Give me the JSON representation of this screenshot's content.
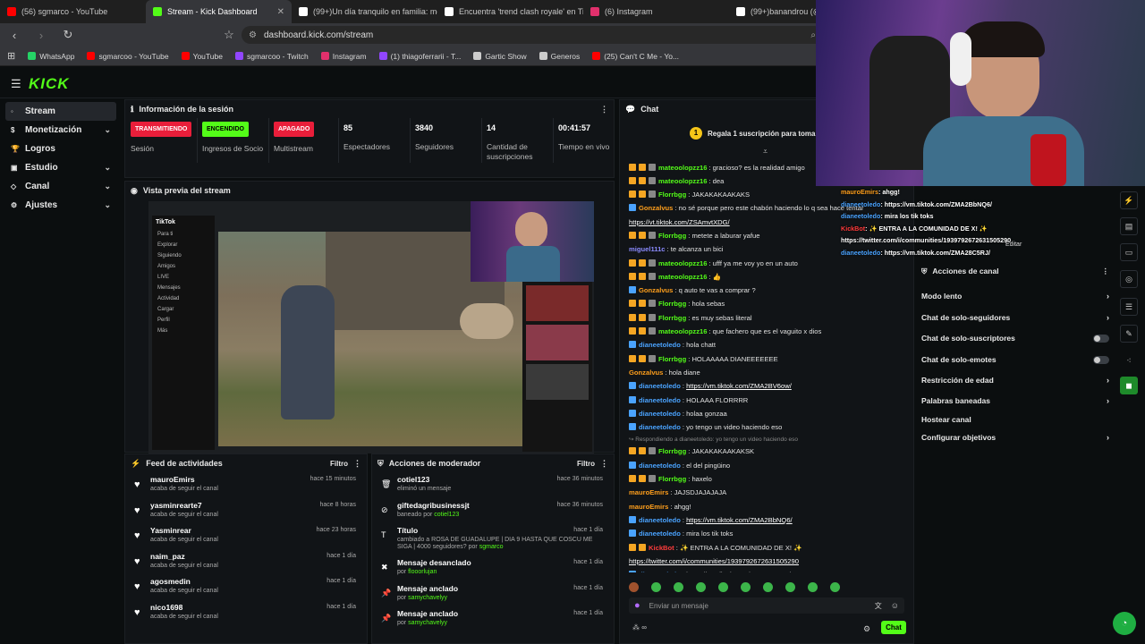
{
  "browser": {
    "tabs": [
      {
        "title": "(56) sgmarco - YouTube",
        "color": "#ff0000",
        "active": false
      },
      {
        "title": "Stream - Kick Dashboard",
        "color": "#53fc18",
        "active": true
      },
      {
        "title": "(99+)Un día tranquilo en familia: mo",
        "color": "#ffffff",
        "active": false
      },
      {
        "title": "Encuentra 'trend clash royale' en Tik",
        "color": "#ffffff",
        "active": false
      },
      {
        "title": "(6) Instagram",
        "color": "#e1306c",
        "active": false
      },
      {
        "title": "(99+)banandrou (@b",
        "color": "#ffffff",
        "active": false
      }
    ],
    "url": "dashboard.kick.com/stream",
    "bookmarks": [
      {
        "label": "WhatsApp",
        "color": "#25d366"
      },
      {
        "label": "sgmarcoo - YouTube",
        "color": "#ff0000"
      },
      {
        "label": "YouTube",
        "color": "#ff0000"
      },
      {
        "label": "sgmarcoo - Twitch",
        "color": "#9146ff"
      },
      {
        "label": "Instagram",
        "color": "#e1306c"
      },
      {
        "label": "(1) thiagoferrarii - T...",
        "color": "#9146ff"
      },
      {
        "label": "Gartic Show",
        "color": "#cccccc"
      },
      {
        "label": "Generos",
        "color": "#cccccc"
      },
      {
        "label": "(25) Can't C Me - Yo...",
        "color": "#ff0000"
      }
    ]
  },
  "app": {
    "logo": "KICK",
    "accent": "#53fc18"
  },
  "sidebar": {
    "items": [
      {
        "label": "Stream",
        "active": true,
        "chevron": false
      },
      {
        "label": "Monetización",
        "active": false,
        "chevron": true
      },
      {
        "label": "Logros",
        "active": false,
        "chevron": false
      },
      {
        "label": "Estudio",
        "active": false,
        "chevron": true
      },
      {
        "label": "Canal",
        "active": false,
        "chevron": true
      },
      {
        "label": "Ajustes",
        "active": false,
        "chevron": true
      }
    ]
  },
  "session": {
    "title": "Información de la sesión",
    "stats": [
      {
        "badge": "TRANSMITIENDO",
        "badge_color": "#e91e3a",
        "label": "Sesión"
      },
      {
        "badge": "ENCENDIDO",
        "badge_color": "#53fc18",
        "label": "Ingresos de Socio"
      },
      {
        "badge": "APAGADO",
        "badge_color": "#e91e3a",
        "label": "Multistream"
      },
      {
        "value": "85",
        "label": "Espectadores"
      },
      {
        "value": "3840",
        "label": "Seguidores"
      },
      {
        "value": "14",
        "label": "Cantidad de suscripciones"
      },
      {
        "value": "00:41:57",
        "label": "Tiempo en vivo"
      }
    ]
  },
  "preview": {
    "title": "Vista previa del stream"
  },
  "activity": {
    "title": "Feed de actividades",
    "filter": "Filtro",
    "items": [
      {
        "name": "mauroEmirs",
        "sub": "acaba de seguir el canal",
        "time": "hace 15 minutos"
      },
      {
        "name": "yasminrearte7",
        "sub": "acaba de seguir el canal",
        "time": "hace 8 horas"
      },
      {
        "name": "Yasminrear",
        "sub": "acaba de seguir el canal",
        "time": "hace 23 horas"
      },
      {
        "name": "naim_paz",
        "sub": "acaba de seguir el canal",
        "time": "hace 1 día"
      },
      {
        "name": "agosmedin",
        "sub": "acaba de seguir el canal",
        "time": "hace 1 día"
      },
      {
        "name": "nico1698",
        "sub": "acaba de seguir el canal",
        "time": "hace 1 día"
      }
    ]
  },
  "mod": {
    "title": "Acciones de moderador",
    "filter": "Filtro",
    "items": [
      {
        "name": "cotiel123",
        "sub": "eliminó un mensaje",
        "by": "",
        "time": "hace 36 minutos",
        "icon": "🗑"
      },
      {
        "name": "giftedagribusinessjt",
        "sub": "baneado por",
        "by": "cotiel123",
        "time": "hace 36 minutos",
        "icon": "⊘"
      },
      {
        "name": "Título",
        "sub": "cambiado a ROSA DE GUADALUPE | DIA 9 HASTA QUE COSCU ME SIGA | 4000 seguidores? por",
        "by": "sgmarco",
        "time": "hace 1 día",
        "icon": "T"
      },
      {
        "name": "Mensaje desanclado",
        "sub": "por",
        "by": "flooorlujan",
        "time": "hace 1 día",
        "icon": "✖"
      },
      {
        "name": "Mensaje anclado",
        "sub": "por",
        "by": "samychavelyy",
        "time": "hace 1 día",
        "icon": "📌"
      },
      {
        "name": "Mensaje anclado",
        "sub": "por",
        "by": "samychavelyy",
        "time": "hace 1 día",
        "icon": "📌"
      }
    ]
  },
  "chat": {
    "title": "Chat",
    "gift_count": "1",
    "gift_text": "Regala 1 suscripción para tomar la p",
    "placeholder": "Enviar un mensaje",
    "send": "Chat",
    "messages": [
      {
        "u": "mateoolopzz16",
        "c": "#53fc18",
        "t": "gracioso? es la realidad amigo",
        "badges": 3
      },
      {
        "u": "mateoolopzz16",
        "c": "#53fc18",
        "t": "dea",
        "badges": 3
      },
      {
        "u": "Florrbgg",
        "c": "#53fc18",
        "t": "JAKAKAKAAKAKS",
        "badges": 3
      },
      {
        "u": "Gonzalvus",
        "c": "#ff9f1c",
        "t": "no sé porque pero este chabón haciendo lo q sea hace tentar",
        "badges": 1
      },
      {
        "u": "",
        "c": "#ffffff",
        "t": "",
        "link": "https://vt.tiktok.com/ZSAmvtXDG/",
        "badges": 0
      },
      {
        "u": "Florrbgg",
        "c": "#53fc18",
        "t": "metete a laburar yafue",
        "badges": 3
      },
      {
        "u": "miguel111c",
        "c": "#8b8bff",
        "t": "te alcanza un bici",
        "badges": 0
      },
      {
        "u": "mateoolopzz16",
        "c": "#53fc18",
        "t": "ufff ya me voy yo en un auto",
        "badges": 3
      },
      {
        "u": "mateoolopzz16",
        "c": "#53fc18",
        "t": "👍",
        "badges": 3
      },
      {
        "u": "Gonzalvus",
        "c": "#ff9f1c",
        "t": "q auto te vas a comprar ?",
        "badges": 1
      },
      {
        "u": "Florrbgg",
        "c": "#53fc18",
        "t": "hola sebas",
        "badges": 3
      },
      {
        "u": "Florrbgg",
        "c": "#53fc18",
        "t": "es muy sebas literal",
        "badges": 3
      },
      {
        "u": "mateoolopzz16",
        "c": "#53fc18",
        "t": "que fachero que es el vaguito x dios",
        "badges": 3
      },
      {
        "u": "dianeetoledo",
        "c": "#4aa3ff",
        "t": "hola chatt",
        "badges": 1
      },
      {
        "u": "Florrbgg",
        "c": "#53fc18",
        "t": "HOLAAAAA DIANEEEEEEE",
        "badges": 3
      },
      {
        "u": "Gonzalvus",
        "c": "#ff9f1c",
        "t": "hola diane",
        "badges": 0
      },
      {
        "u": "dianeetoledo",
        "c": "#4aa3ff",
        "t": "",
        "link": "https://vm.tiktok.com/ZMA2BV6ow/",
        "badges": 1
      },
      {
        "u": "dianeetoledo",
        "c": "#4aa3ff",
        "t": "HOLAAA FLORRRR",
        "badges": 1
      },
      {
        "u": "dianeetoledo",
        "c": "#4aa3ff",
        "t": "holaa gonzaa",
        "badges": 1
      },
      {
        "u": "dianeetoledo",
        "c": "#4aa3ff",
        "t": "yo tengo un video haciendo eso",
        "badges": 1
      },
      {
        "u": "",
        "c": "#888888",
        "t": "↪ Respondiendo a dianeetoledo: yo tengo un video haciendo eso",
        "badges": 0,
        "small": true
      },
      {
        "u": "Florrbgg",
        "c": "#53fc18",
        "t": "JAKAKAKAAKAKSK",
        "badges": 3
      },
      {
        "u": "dianeetoledo",
        "c": "#4aa3ff",
        "t": "el del pingüino",
        "badges": 1
      },
      {
        "u": "Florrbgg",
        "c": "#53fc18",
        "t": "haxelo",
        "badges": 3
      },
      {
        "u": "mauroEmirs",
        "c": "#ff9f1c",
        "t": "JAJSDJAJAJAJA",
        "badges": 0
      },
      {
        "u": "mauroEmirs",
        "c": "#ff9f1c",
        "t": "ahgg!",
        "badges": 0
      },
      {
        "u": "dianeetoledo",
        "c": "#4aa3ff",
        "t": "",
        "link": "https://vm.tiktok.com/ZMA2BbNQ6/",
        "badges": 1
      },
      {
        "u": "dianeetoledo",
        "c": "#4aa3ff",
        "t": "mira los tik toks",
        "badges": 1
      },
      {
        "u": "KickBot",
        "c": "#ff3b3b",
        "t": "✨ ENTRA A LA COMUNIDAD DE X! ✨",
        "badges": 2
      },
      {
        "u": "",
        "c": "#ffffff",
        "t": "",
        "link": "https://twitter.com/i/communities/1939792672631505290",
        "badges": 0
      },
      {
        "u": "dianeetoledo",
        "c": "#4aa3ff",
        "t": "",
        "link": "https://vm.tiktok.com/ZMA28C5RJ/",
        "badges": 1
      }
    ]
  },
  "overlay_chat": [
    {
      "u": "mauroEmirs",
      "c": "#ff9f1c",
      "t": "ahgg!"
    },
    {
      "u": "dianeetoledo",
      "c": "#4aa3ff",
      "t": "https://vm.tiktok.com/ZMA2BbNQ6/"
    },
    {
      "u": "dianeetoledo",
      "c": "#4aa3ff",
      "t": "mira los tik toks"
    },
    {
      "u": "KickBot",
      "c": "#ff3b3b",
      "t": "✨ ENTRA A LA COMUNIDAD DE X! ✨"
    },
    {
      "u": "",
      "c": "#ffffff",
      "t": "https://twitter.com/i/communities/1939792672631505290"
    },
    {
      "u": "dianeetoledo",
      "c": "#4aa3ff",
      "t": "https://vm.tiktok.com/ZMA28C5RJ/"
    }
  ],
  "overlay_edit": "Editar",
  "channel_actions": {
    "title": "Acciones de canal",
    "items": [
      {
        "label": "Modo lento",
        "kind": "arrow"
      },
      {
        "label": "Chat de solo-seguidores",
        "kind": "arrow"
      },
      {
        "label": "Chat de solo-suscriptores",
        "kind": "toggle"
      },
      {
        "label": "Chat de solo-emotes",
        "kind": "toggle"
      },
      {
        "label": "Restricción de edad",
        "kind": "arrow"
      },
      {
        "label": "Palabras baneadas",
        "kind": "arrow"
      },
      {
        "label": "Hostear canal",
        "kind": "none"
      },
      {
        "label": "Configurar objetivos",
        "kind": "arrow"
      }
    ]
  },
  "preview_bits": {
    "tiktok": "TikTok",
    "menu": [
      "Para ti",
      "Explorar",
      "Siguiendo",
      "Amigos",
      "LIVE",
      "Mensajes",
      "Actividad",
      "Cargar",
      "Perfil",
      "Más"
    ]
  }
}
